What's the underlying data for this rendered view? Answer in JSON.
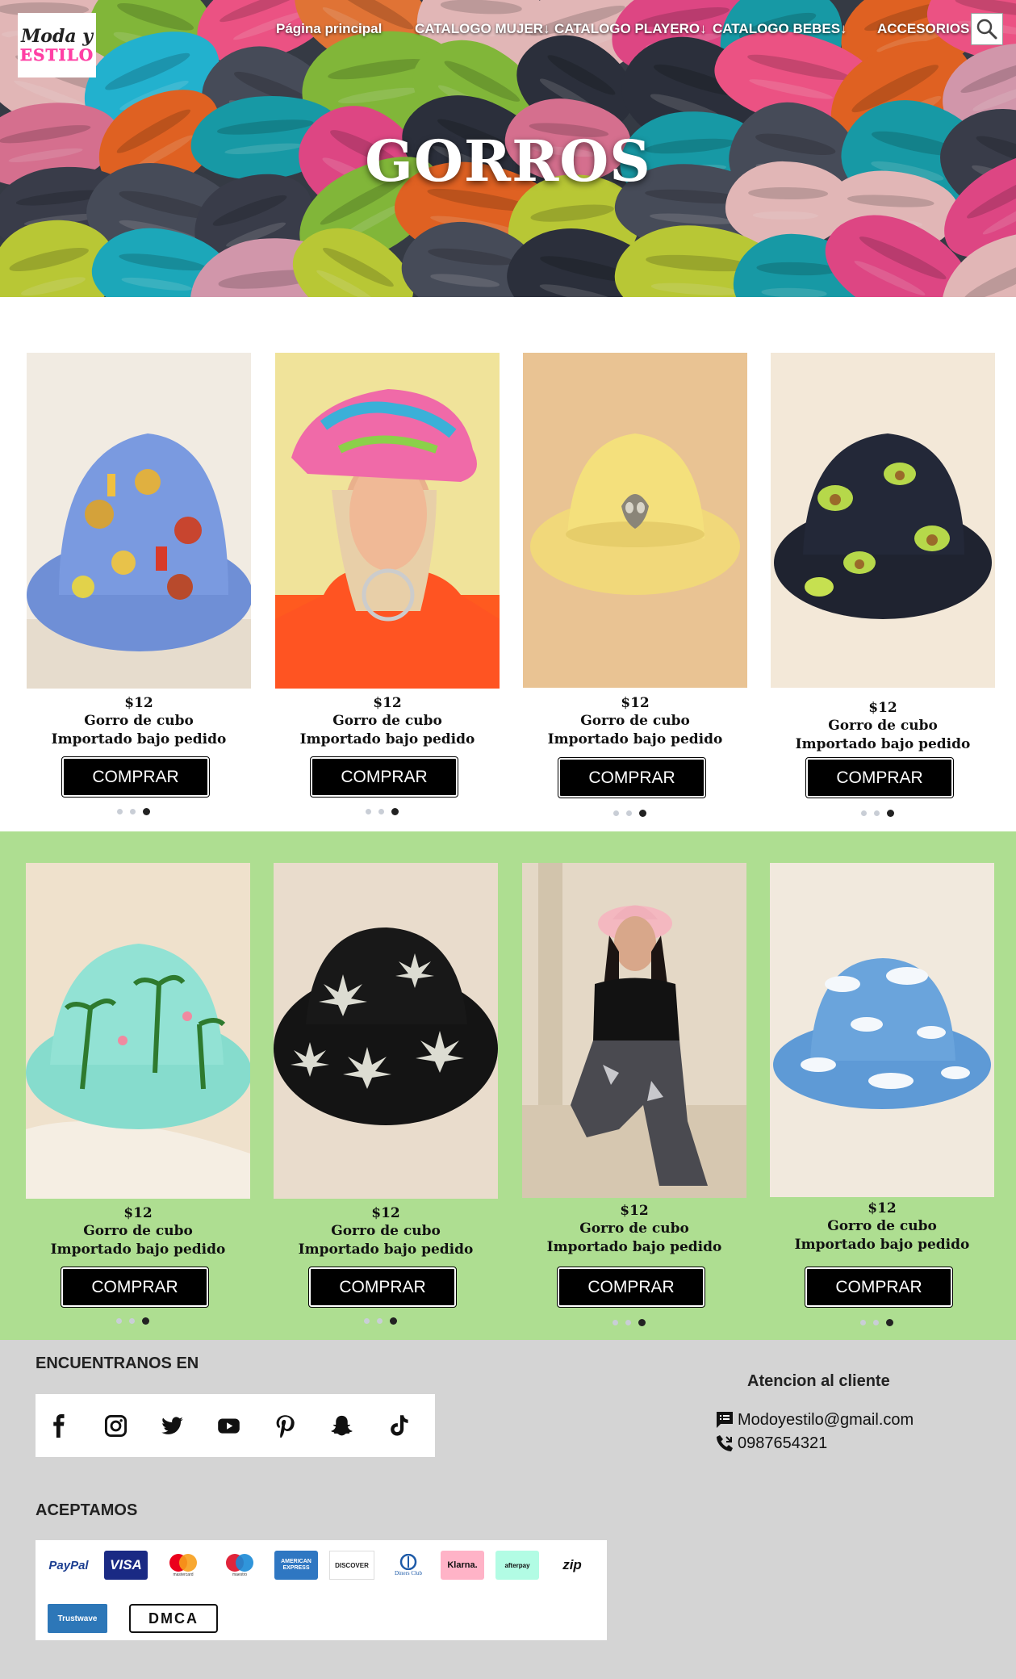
{
  "brand": {
    "line1": "Moda y",
    "line2": "ESTILO"
  },
  "nav": [
    {
      "label": "Página principal"
    },
    {
      "label": "CATALOGO MUJER↓"
    },
    {
      "label": "CATALOGO PLAYERO↓"
    },
    {
      "label": "CATALOGO BEBES↓"
    },
    {
      "label": "ACCESORIOS↓"
    }
  ],
  "hero": {
    "title": "GORROS"
  },
  "products_row1": [
    {
      "price": "$12",
      "name": "Gorro de cubo",
      "note": "Importado bajo pedido",
      "button": "COMPRAR",
      "image": "bucket-hat-food-print"
    },
    {
      "price": "$12",
      "name": "Gorro de cubo",
      "note": "Importado bajo pedido",
      "button": "COMPRAR",
      "image": "model-tie-dye-bucket-hat"
    },
    {
      "price": "$12",
      "name": "Gorro de cubo",
      "note": "Importado bajo pedido",
      "button": "COMPRAR",
      "image": "yellow-alien-bucket-hat"
    },
    {
      "price": "$12",
      "name": "Gorro de cubo",
      "note": "Importado bajo pedido",
      "button": "COMPRAR",
      "image": "avocado-print-bucket-hat"
    }
  ],
  "products_row2": [
    {
      "price": "$12",
      "name": "Gorro de cubo",
      "note": "Importado bajo pedido",
      "button": "COMPRAR",
      "image": "palm-tree-bucket-hat"
    },
    {
      "price": "$12",
      "name": "Gorro de cubo",
      "note": "Importado bajo pedido",
      "button": "COMPRAR",
      "image": "black-leaf-print-bucket-hat"
    },
    {
      "price": "$12",
      "name": "Gorro de cubo",
      "note": "Importado bajo pedido",
      "button": "COMPRAR",
      "image": "model-pink-bucket-hat"
    },
    {
      "price": "$12",
      "name": "Gorro de cubo",
      "note": "Importado bajo pedido",
      "button": "COMPRAR",
      "image": "sky-clouds-bucket-hat"
    }
  ],
  "footer": {
    "social_title": "ENCUENTRANOS EN",
    "social": [
      "facebook-icon",
      "instagram-icon",
      "twitter-icon",
      "youtube-icon",
      "pinterest-icon",
      "snapchat-icon",
      "tiktok-icon"
    ],
    "payments_title": "ACEPTAMOS",
    "payments": [
      {
        "label": "PayPal"
      },
      {
        "label": "VISA"
      },
      {
        "label": "mastercard"
      },
      {
        "label": "maestro"
      },
      {
        "label": "AMERICAN EXPRESS"
      },
      {
        "label": "DISCOVER"
      },
      {
        "label": "Diners Club"
      },
      {
        "label": "Klarna."
      },
      {
        "label": "afterpay"
      },
      {
        "label": "zip"
      },
      {
        "label": "Trustwave"
      },
      {
        "label": "DMCA"
      }
    ],
    "contact_title": "Atencion al cliente",
    "email": "Modoyestilo@gmail.com",
    "phone": "0987654321"
  },
  "colors": {
    "green_section": "#aede91",
    "footer_bg": "#d4d4d4",
    "button_bg": "#000000",
    "logo_pink": "#ff3fa4"
  }
}
